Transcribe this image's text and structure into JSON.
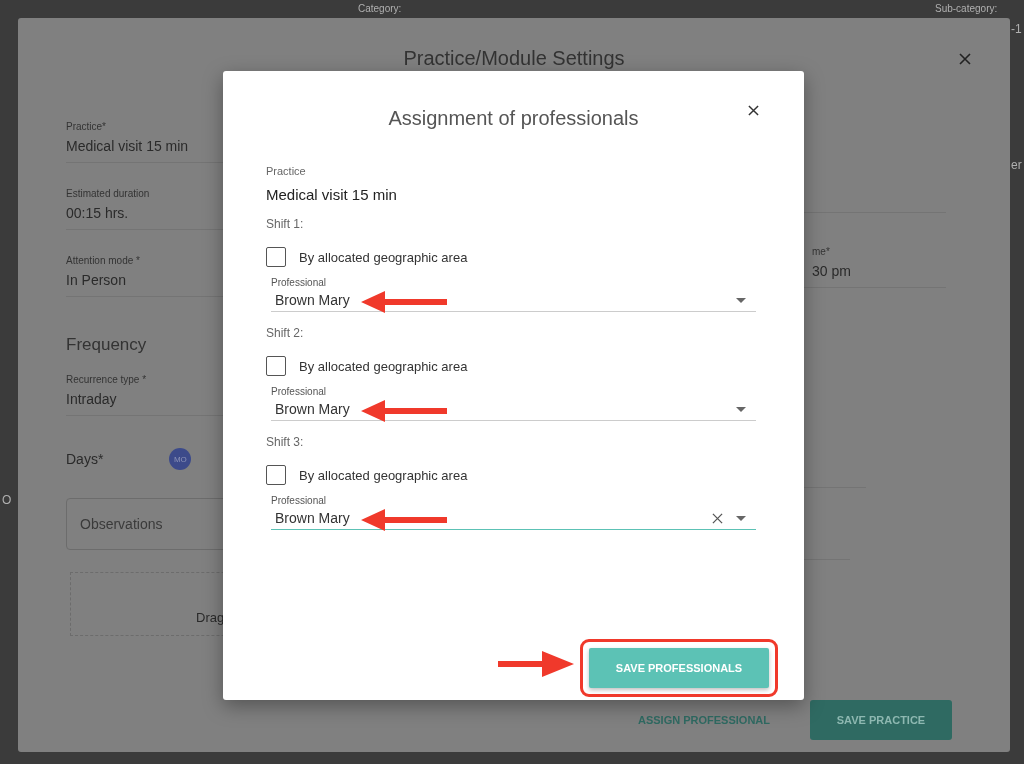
{
  "page": {
    "category_label": "Category:",
    "subcategory_label": "Sub-category:",
    "edge_fragments": [
      {
        "text": "-1"
      },
      {
        "text": "er"
      },
      {
        "text": "O"
      }
    ]
  },
  "settings_modal": {
    "title": "Practice/Module Settings",
    "fields": [
      {
        "label": "Practice*",
        "value": "Medical visit 15 min"
      },
      {
        "label": "Estimated duration",
        "value": "00:15 hrs."
      },
      {
        "label": "Attention mode *",
        "value": "In Person"
      }
    ],
    "frequency_heading": "Frequency",
    "recurrence": {
      "label": "Recurrence type *",
      "value": "Intraday"
    },
    "days_label": "Days*",
    "day_chips": [
      {
        "label": "MO",
        "selected": true
      }
    ],
    "observations_placeholder": "Observations",
    "drop_zone_text": "Drag",
    "right_field": {
      "label": "me*",
      "value": "30 pm"
    },
    "assign_button": "ASSIGN PROFESSIONAL",
    "save_button": "SAVE PRACTICE"
  },
  "assignment_dialog": {
    "title": "Assignment of professionals",
    "practice_label": "Practice",
    "practice_value": "Medical visit 15 min",
    "shifts": [
      {
        "label": "Shift 1:",
        "checkbox_label": "By allocated geographic area",
        "checked": false,
        "professional": {
          "label": "Professional",
          "value": "Brown Mary",
          "focused": false
        }
      },
      {
        "label": "Shift 2:",
        "checkbox_label": "By allocated geographic area",
        "checked": false,
        "professional": {
          "label": "Professional",
          "value": "Brown Mary",
          "focused": false
        }
      },
      {
        "label": "Shift 3:",
        "checkbox_label": "By allocated geographic area",
        "checked": false,
        "professional": {
          "label": "Professional",
          "value": "Brown Mary",
          "focused": true
        }
      }
    ],
    "save_button": "SAVE PROFESSIONALS"
  }
}
